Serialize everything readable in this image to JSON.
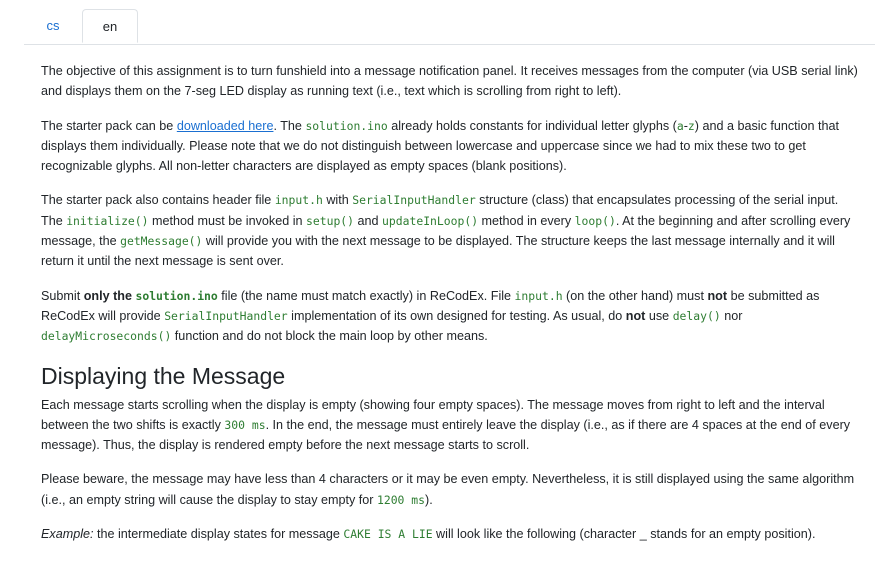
{
  "tabs": [
    {
      "label": "cs",
      "active": false
    },
    {
      "label": "en",
      "active": true
    }
  ],
  "p1": {
    "text": "The objective of this assignment is to turn funshield into a message notification panel. It receives messages from the computer (via USB serial link) and displays them on the 7-seg LED display as running text (i.e., text which is scrolling from right to left)."
  },
  "p2": {
    "t1": "The starter pack can be ",
    "link": "downloaded here",
    "t2": ". The ",
    "code1": "solution.ino",
    "t3": " already holds constants for individual letter glyphs (",
    "code2": "a",
    "t4": "-",
    "code3": "z",
    "t5": ") and a basic function that displays them individually. Please note that we do not distinguish between lowercase and uppercase since we had to mix these two to get recognizable glyphs. All non-letter characters are displayed as empty spaces (blank positions)."
  },
  "p3": {
    "t1": "The starter pack also contains header file ",
    "code1": "input.h",
    "t2": " with ",
    "code2": "SerialInputHandler",
    "t3": " structure (class) that encapsulates processing of the serial input. The ",
    "code3": "initialize()",
    "t4": " method must be invoked in ",
    "code4": "setup()",
    "t5": " and ",
    "code5": "updateInLoop()",
    "t6": " method in every ",
    "code6": "loop()",
    "t7": ". At the beginning and after scrolling every message, the ",
    "code7": "getMessage()",
    "t8": " will provide you with the next message to be displayed. The structure keeps the last message internally and it will return it until the next message is sent over."
  },
  "p4": {
    "t1": "Submit ",
    "b1": "only the ",
    "bcode": "solution.ino",
    "t2": " file (the name must match exactly) in ReCodEx. File ",
    "code1": "input.h",
    "t3": " (on the other hand) must ",
    "b2": "not",
    "t4": " be submitted as ReCodEx will provide ",
    "code2": "SerialInputHandler",
    "t5": " implementation of its own designed for testing. As usual, do ",
    "b3": "not",
    "t6": " use ",
    "code3": "delay()",
    "t7": " nor ",
    "code4": "delayMicroseconds()",
    "t8": " function and do not block the main loop by other means."
  },
  "heading": "Displaying the Message",
  "p5": {
    "t1": "Each message starts scrolling when the display is empty (showing four empty spaces). The message moves from right to left and the interval between the two shifts is exactly ",
    "code1": "300 ms",
    "t2": ". In the end, the message must entirely leave the display (i.e., as if there are 4 spaces at the end of every message). Thus, the display is rendered empty before the next message starts to scroll."
  },
  "p6": {
    "t1": "Please beware, the message may have less than 4 characters or it may be even empty. Nevertheless, it is still displayed using the same algorithm (i.e., an empty string will cause the display to stay empty for ",
    "code1": "1200 ms",
    "t2": ")."
  },
  "p7": {
    "italic": "Example:",
    "t1": " the intermediate display states for message ",
    "code1": "CAKE IS A LIE",
    "t2": " will look like the following (character _ stands for an empty position)."
  },
  "colors": {
    "link": "#1a6fd1",
    "code": "#2e7d32",
    "text": "#212529",
    "tab_border": "#dee2e6"
  }
}
